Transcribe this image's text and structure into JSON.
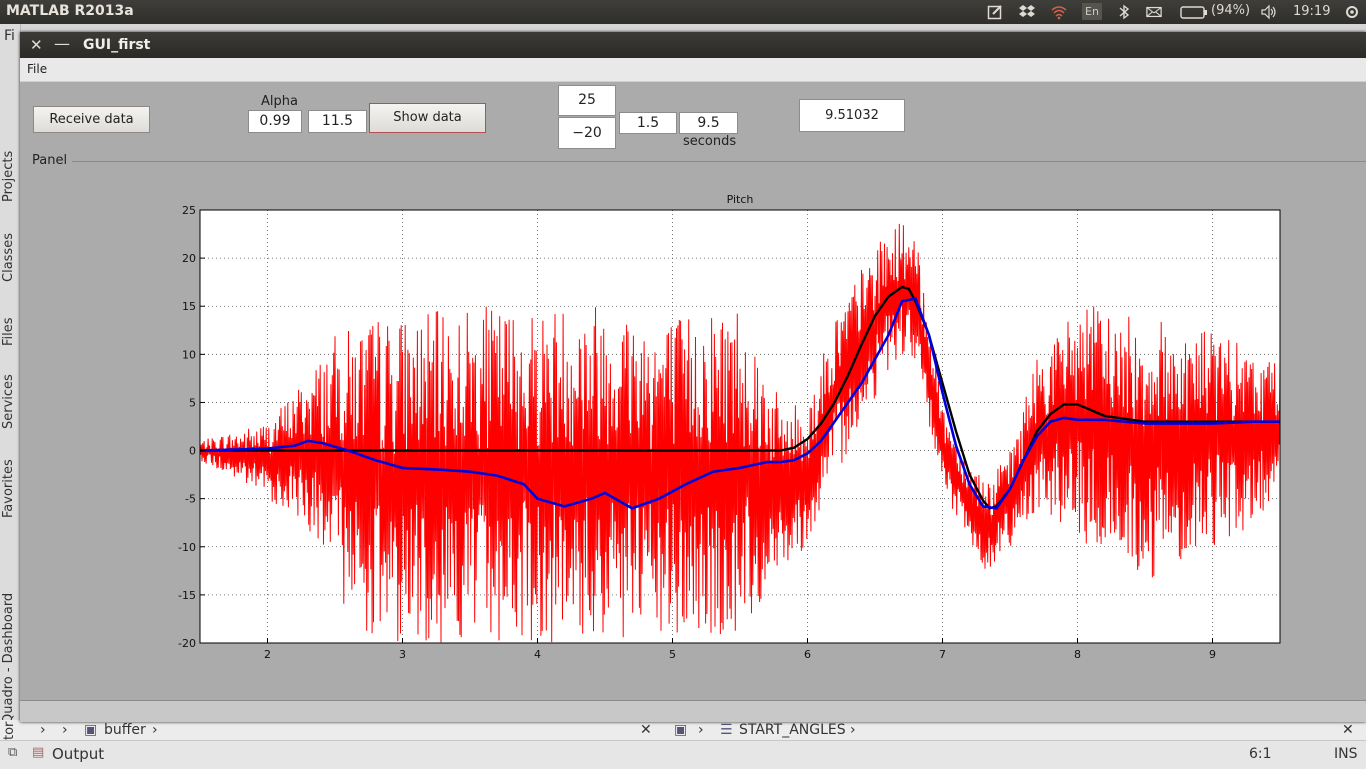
{
  "system_bar": {
    "app_title": "MATLAB R2013a",
    "keyboard_layout": "En",
    "battery": "(94%)",
    "clock": "19:19",
    "icons": [
      "edit-icon",
      "dropbox-icon",
      "wifi-icon",
      "bluetooth-icon",
      "mail-icon",
      "battery-icon",
      "volume-icon"
    ]
  },
  "ide": {
    "left_tabs": [
      "Projects",
      "Classes",
      "Files",
      "Services",
      "Favorites",
      "Quadro - Dashboard",
      "tor"
    ],
    "left_top_label": "Fi",
    "editor_tabs": [
      "buffer",
      "START_ANGLES"
    ],
    "output_label": "Output",
    "cursor_position": "6:1",
    "insert_mode": "INS"
  },
  "gui": {
    "title": "GUI_first",
    "menu": [
      "File"
    ],
    "receive_button": "Receive data",
    "alpha_label": "Alpha",
    "alpha_value": "0.99",
    "second_value": "11.5",
    "show_button": "Show data",
    "y_max_field": "25",
    "y_min_field": "−20",
    "t_start_field": "1.5",
    "t_end_field": "9.5",
    "seconds_label": "seconds",
    "result_value": "9.51032",
    "panel_label": "Panel"
  },
  "chart_data": {
    "type": "line",
    "title": "Pitch",
    "xlabel": "",
    "ylabel": "",
    "xlim": [
      1.5,
      9.5
    ],
    "ylim": [
      -20,
      25
    ],
    "x_ticks": [
      2,
      3,
      4,
      5,
      6,
      7,
      8,
      9
    ],
    "y_ticks": [
      25,
      20,
      15,
      10,
      5,
      0,
      -5,
      -10,
      -15,
      -20
    ],
    "grid": true,
    "series": [
      {
        "color": "#ff0000",
        "style": "noisy raw signal",
        "envelope_x": [
          1.5,
          2.0,
          2.3,
          2.5,
          2.8,
          3.0,
          3.5,
          4.0,
          4.5,
          5.0,
          5.5,
          5.8,
          6.0,
          6.2,
          6.4,
          6.6,
          6.7,
          6.8,
          6.9,
          7.0,
          7.2,
          7.35,
          7.5,
          7.7,
          7.9,
          8.0,
          8.3,
          8.5,
          8.8,
          9.0,
          9.3,
          9.5
        ],
        "envelope_upper": [
          1,
          3,
          8,
          12,
          14,
          14,
          15,
          15,
          16,
          14,
          16,
          5,
          5,
          14,
          19,
          23,
          24,
          22,
          15,
          5,
          -1,
          -3,
          0,
          10,
          13,
          16,
          14,
          14,
          13,
          13,
          10,
          10
        ],
        "envelope_lower": [
          -1,
          -5,
          -8,
          -15,
          -20,
          -20,
          -20,
          -20,
          -20,
          -20,
          -20,
          -12,
          -10,
          -3,
          3,
          8,
          10,
          8,
          2,
          -4,
          -10,
          -13,
          -10,
          -6,
          -8,
          -10,
          -11,
          -14,
          -11,
          -10,
          -8,
          -5
        ]
      },
      {
        "color": "#000000",
        "style": "filtered",
        "x": [
          1.5,
          2.0,
          2.5,
          3.0,
          3.5,
          4.0,
          4.5,
          5.0,
          5.5,
          5.8,
          5.9,
          6.0,
          6.1,
          6.2,
          6.3,
          6.4,
          6.5,
          6.6,
          6.7,
          6.75,
          6.8,
          6.9,
          7.0,
          7.1,
          7.2,
          7.3,
          7.35,
          7.4,
          7.5,
          7.6,
          7.7,
          7.8,
          7.9,
          8.0,
          8.1,
          8.2,
          8.5,
          8.8,
          9.0,
          9.3,
          9.5
        ],
        "y": [
          0,
          0,
          0,
          0,
          0,
          0,
          0,
          0,
          0,
          0,
          0.3,
          1.2,
          2.8,
          5,
          7.8,
          11,
          14,
          16,
          17,
          16.8,
          15.5,
          12,
          7,
          2,
          -2.5,
          -5.2,
          -6,
          -5.8,
          -4,
          -1,
          2,
          3.8,
          4.8,
          4.8,
          4.2,
          3.6,
          3,
          3,
          3,
          3,
          3
        ]
      },
      {
        "color": "#0000dd",
        "style": "filtered",
        "x": [
          1.5,
          2.0,
          2.2,
          2.3,
          2.4,
          2.6,
          2.8,
          3.0,
          3.3,
          3.5,
          3.7,
          3.9,
          4.0,
          4.2,
          4.4,
          4.5,
          4.7,
          4.9,
          5.1,
          5.3,
          5.5,
          5.7,
          5.8,
          5.9,
          6.0,
          6.1,
          6.2,
          6.4,
          6.6,
          6.7,
          6.8,
          6.9,
          7.0,
          7.1,
          7.2,
          7.3,
          7.4,
          7.5,
          7.6,
          7.7,
          7.8,
          7.9,
          8.0,
          8.2,
          8.5,
          8.8,
          9.0,
          9.3,
          9.5
        ],
        "y": [
          0,
          0.2,
          0.5,
          1,
          0.8,
          0,
          -1,
          -1.8,
          -2,
          -2.2,
          -2.6,
          -3.5,
          -5,
          -5.8,
          -5,
          -4.4,
          -6,
          -5,
          -3.5,
          -2.2,
          -1.8,
          -1.2,
          -1.2,
          -1,
          -0.3,
          1,
          3,
          7,
          12,
          15.5,
          15.8,
          12,
          6,
          0.5,
          -3.5,
          -5.8,
          -6,
          -4,
          -1,
          1.5,
          3,
          3.4,
          3.2,
          3.2,
          2.8,
          2.8,
          2.8,
          3,
          3
        ]
      }
    ]
  }
}
